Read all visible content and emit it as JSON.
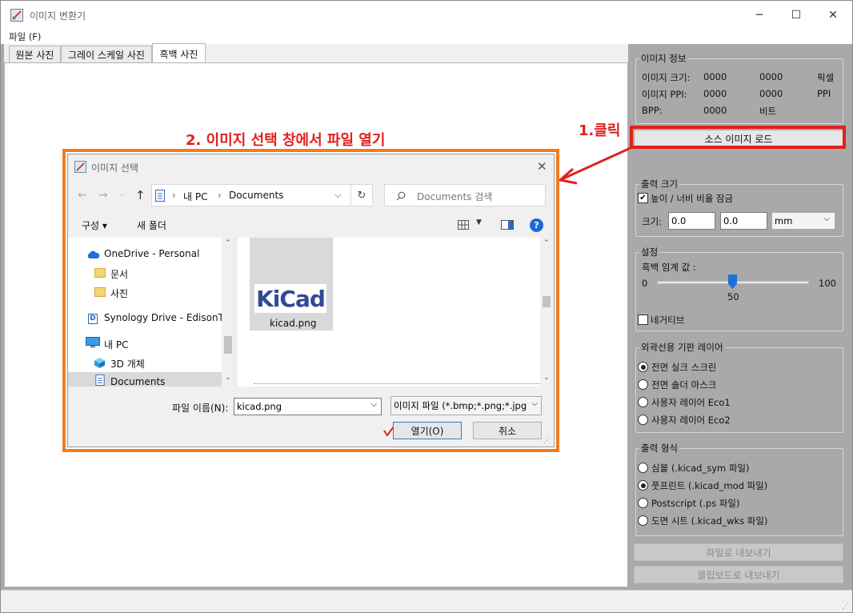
{
  "window": {
    "title": "이미지 변환기",
    "controls": [
      "─",
      "☐",
      "✕"
    ]
  },
  "menu": {
    "file": "파일 (F)"
  },
  "tabs": [
    "원본 사진",
    "그레이 스케일 사진",
    "흑백 사진"
  ],
  "image_info": {
    "group": "이미지 정보",
    "rows": [
      {
        "label": "이미지 크기:",
        "v1": "0000",
        "v2": "0000",
        "unit": "픽셀"
      },
      {
        "label": "이미지 PPI:",
        "v1": "0000",
        "v2": "0000",
        "unit": "PPI"
      },
      {
        "label": "BPP:",
        "v1": "0000",
        "v2": "비트",
        "unit": ""
      }
    ]
  },
  "load_button": "소스 이미지 로드",
  "output_size": {
    "group": "출력 크기",
    "lock_label": "높이 / 너비 비율 잠금",
    "lock_checked": true,
    "size_label": "크기:",
    "width": "0.0",
    "height": "0.0",
    "unit": "mm"
  },
  "settings": {
    "group": "설정",
    "threshold_label": "흑백 임계 값 :",
    "min": "0",
    "max": "100",
    "value": "50",
    "negative_label": "네거티브"
  },
  "board_layer": {
    "group": "외곽선용 기판 레이어",
    "options": [
      "전면 실크 스크린",
      "전면 솔더 마스크",
      "사용자 레이어 Eco1",
      "사용자 레이어 Eco2"
    ],
    "selected": 0
  },
  "output_format": {
    "group": "출력 형식",
    "options": [
      "심볼 (.kicad_sym 파일)",
      "풋프린트 (.kicad_mod 파일)",
      "Postscript (.ps 파일)",
      "도면 시트 (.kicad_wks 파일)"
    ],
    "selected": 1
  },
  "export_file": "파일로 내보내기",
  "export_clipboard": "클립보드로 내보내기",
  "annotations": {
    "step1": "1.클릭",
    "step2": "2. 이미지 선택 창에서 파일 열기"
  },
  "dialog": {
    "title": "이미지 선택",
    "breadcrumb": [
      "내 PC",
      "Documents"
    ],
    "search_placeholder": "Documents 검색",
    "organize": "구성 ▾",
    "new_folder": "새 폴더",
    "tree": [
      {
        "label": "OneDrive - Personal",
        "icon": "cloud-icon"
      },
      {
        "label": "문서",
        "icon": "folder-icon"
      },
      {
        "label": "사진",
        "icon": "folder-icon"
      },
      {
        "label": "Synology Drive - EdisonTec",
        "icon": "synology-icon"
      },
      {
        "label": "내 PC",
        "icon": "pc-icon"
      },
      {
        "label": "3D 개체",
        "icon": "cube-icon"
      },
      {
        "label": "Documents",
        "icon": "document-icon"
      }
    ],
    "file": {
      "name": "kicad.png",
      "logo_text": "KiCad"
    },
    "filename_label": "파일 이름(N):",
    "filename_value": "kicad.png",
    "filter": "이미지 파일 (*.bmp;*.png;*.jpg",
    "open": "열기(O)",
    "cancel": "취소"
  },
  "colors": {
    "annotation_red": "#e0201d",
    "frame_orange": "#f07d20",
    "panel_gray": "#a9a9a9",
    "kicad_blue": "#314a97"
  }
}
